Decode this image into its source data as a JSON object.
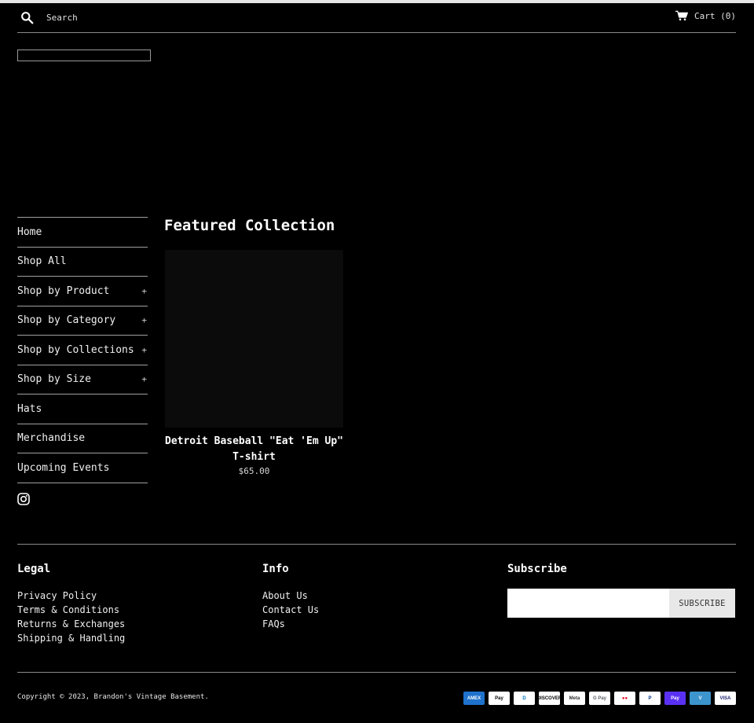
{
  "header": {
    "search_placeholder": "Search",
    "cart_label": "Cart (0)"
  },
  "nav": {
    "items": [
      {
        "label": "Home",
        "expandable": false
      },
      {
        "label": "Shop All",
        "expandable": false
      },
      {
        "label": "Shop by Product",
        "expandable": true
      },
      {
        "label": "Shop by Category",
        "expandable": true
      },
      {
        "label": "Shop by Collections",
        "expandable": true
      },
      {
        "label": "Shop by Size",
        "expandable": true
      },
      {
        "label": "Hats",
        "expandable": false
      },
      {
        "label": "Merchandise",
        "expandable": false
      },
      {
        "label": "Upcoming Events",
        "expandable": false
      }
    ],
    "expand_symbol": "+",
    "social_icon": "instagram-icon"
  },
  "featured": {
    "title": "Featured Collection",
    "product": {
      "title": "Detroit Baseball \"Eat 'Em Up\" T-shirt",
      "price": "$65.00"
    }
  },
  "footer": {
    "legal": {
      "heading": "Legal",
      "links": [
        "Privacy Policy",
        "Terms & Conditions",
        "Returns & Exchanges",
        "Shipping & Handling"
      ]
    },
    "info": {
      "heading": "Info",
      "links": [
        "About Us",
        "Contact Us",
        "FAQs"
      ]
    },
    "subscribe": {
      "heading": "Subscribe",
      "button_label": "SUBSCRIBE"
    },
    "copyright": "Copyright © 2023, Brandon's Vintage Basement."
  },
  "payments": [
    {
      "label": "AMEX",
      "bg": "#1f72cd",
      "fg": "#ffffff"
    },
    {
      "label": "Pay",
      "bg": "#ffffff",
      "fg": "#000000"
    },
    {
      "label": "D",
      "bg": "#ffffff",
      "fg": "#0079be"
    },
    {
      "label": "DISCOVER",
      "bg": "#ffffff",
      "fg": "#000000"
    },
    {
      "label": "Meta",
      "bg": "#ffffff",
      "fg": "#333333"
    },
    {
      "label": "G Pay",
      "bg": "#ffffff",
      "fg": "#5f6368"
    },
    {
      "label": "●●",
      "bg": "#ffffff",
      "fg": "#eb001b"
    },
    {
      "label": "P",
      "bg": "#ffffff",
      "fg": "#003087"
    },
    {
      "label": "Pay",
      "bg": "#5a31f4",
      "fg": "#ffffff"
    },
    {
      "label": "V",
      "bg": "#3d95ce",
      "fg": "#ffffff"
    },
    {
      "label": "VISA",
      "bg": "#ffffff",
      "fg": "#1a1f71"
    }
  ],
  "colors": {
    "background": "#000000",
    "text": "#ffffff",
    "rule": "#8a8a8a",
    "product_placeholder": "#0b0b0b"
  }
}
